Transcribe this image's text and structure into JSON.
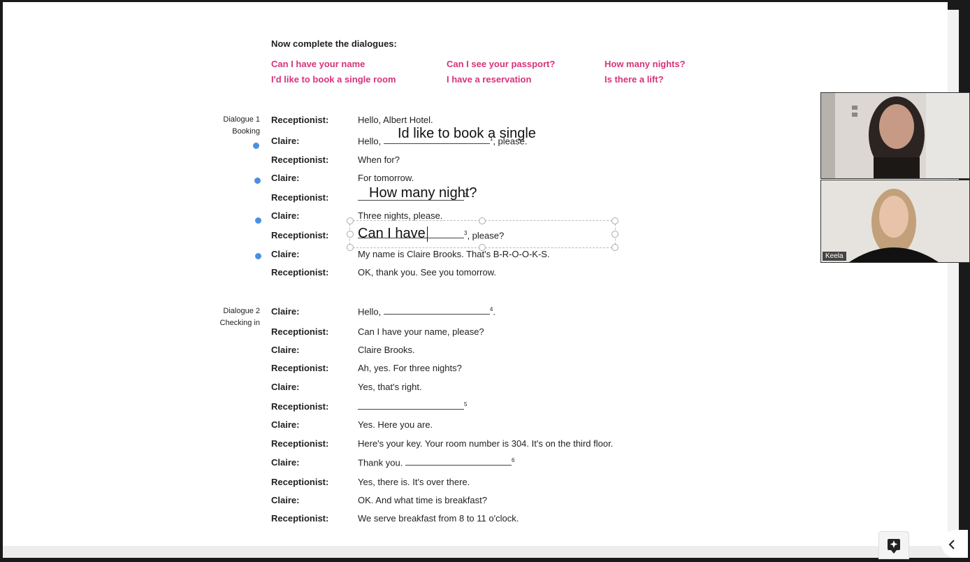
{
  "instructions": "Now complete the dialogues:",
  "options": [
    "Can I have your name",
    "Can I see your passport?",
    "How many nights?",
    "I'd like to book a single room",
    "I have a reservation",
    "Is there a lift?"
  ],
  "dialogue1": {
    "label": "Dialogue 1 Booking",
    "lines": [
      {
        "speaker": "Receptionist:",
        "text": "Hello, Albert Hotel."
      },
      {
        "speaker": "Claire:",
        "pre": "Hello, ",
        "num": "1",
        "post": ", please."
      },
      {
        "speaker": "Receptionist:",
        "text": "When for?"
      },
      {
        "speaker": "Claire:",
        "text": "For tomorrow."
      },
      {
        "speaker": "Receptionist:",
        "pre": "",
        "num": "2",
        "post": ""
      },
      {
        "speaker": "Claire:",
        "text": "Three nights, please."
      },
      {
        "speaker": "Receptionist:",
        "pre": "",
        "num": "3",
        "post": ", please?"
      },
      {
        "speaker": "Claire:",
        "text": "My name is Claire Brooks. That's B-R-O-O-K-S."
      },
      {
        "speaker": "Receptionist:",
        "text": "OK, thank you. See you tomorrow."
      }
    ]
  },
  "dialogue2": {
    "label": "Dialogue 2 Checking in",
    "lines": [
      {
        "speaker": "Claire:",
        "pre": "Hello, ",
        "num": "4",
        "post": "."
      },
      {
        "speaker": "Receptionist:",
        "text": "Can I have your name, please?"
      },
      {
        "speaker": "Claire:",
        "text": "Claire Brooks."
      },
      {
        "speaker": "Receptionist:",
        "text": "Ah, yes. For three nights?"
      },
      {
        "speaker": "Claire:",
        "text": "Yes, that's right."
      },
      {
        "speaker": "Receptionist:",
        "pre": "",
        "num": "5",
        "post": ""
      },
      {
        "speaker": "Claire:",
        "text": "Yes. Here you are."
      },
      {
        "speaker": "Receptionist:",
        "text": "Here's your key. Your room number is 304. It's on the third floor."
      },
      {
        "speaker": "Claire:",
        "pre": "Thank you. ",
        "num": "6",
        "post": ""
      },
      {
        "speaker": "Receptionist:",
        "text": "Yes, there is. It's over there."
      },
      {
        "speaker": "Claire:",
        "text": "OK. And what time is breakfast?"
      },
      {
        "speaker": "Receptionist:",
        "text": "We serve breakfast from 8 to 11 o'clock."
      }
    ]
  },
  "annotations": {
    "a1": "Id like to book a single",
    "a2": "How many night?",
    "a3": "Can I have"
  },
  "participants": {
    "second_name": "Keela"
  },
  "colors": {
    "accent": "#d6337a",
    "dot": "#4a90e2"
  }
}
